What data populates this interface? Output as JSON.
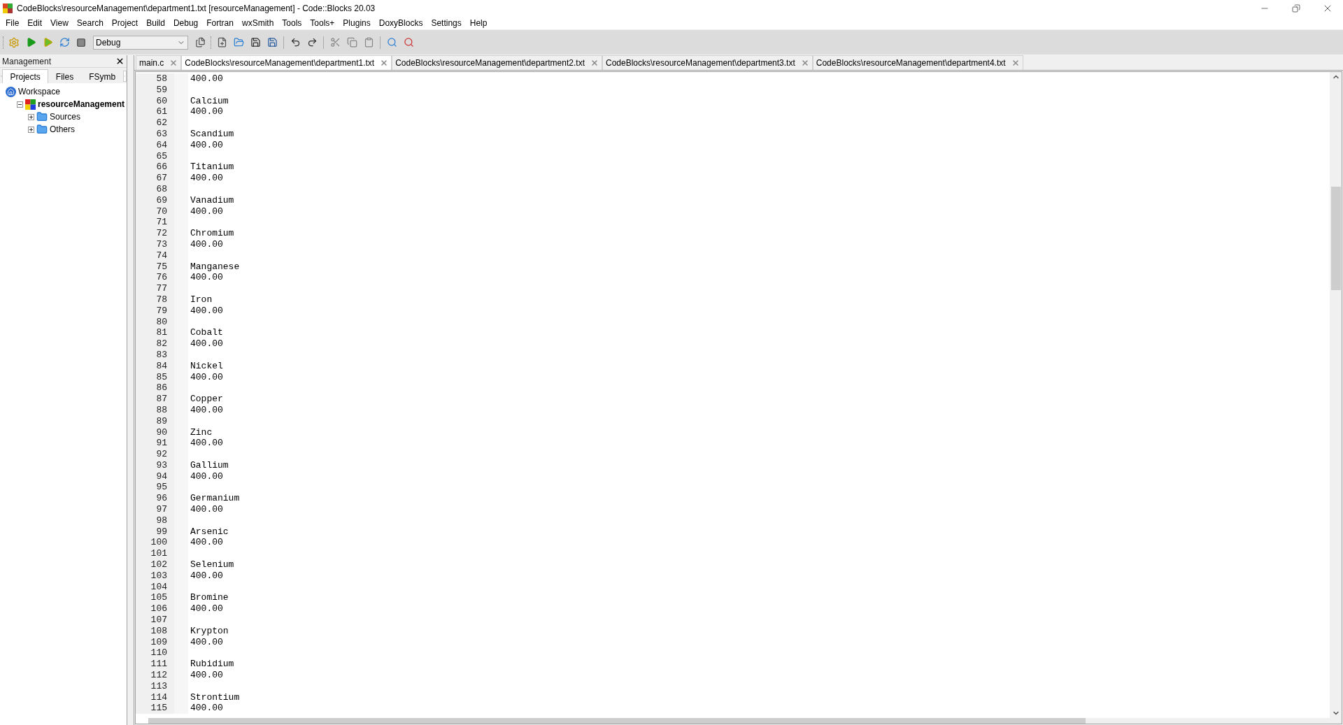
{
  "window": {
    "title": "CodeBlocks\\resourceManagement\\department1.txt [resourceManagement] - Code::Blocks 20.03"
  },
  "menu": [
    "File",
    "Edit",
    "View",
    "Search",
    "Project",
    "Build",
    "Debug",
    "Fortran",
    "wxSmith",
    "Tools",
    "Tools+",
    "Plugins",
    "DoxyBlocks",
    "Settings",
    "Help"
  ],
  "toolbar": {
    "build_target": "Debug"
  },
  "management": {
    "title": "Management",
    "tabs": [
      {
        "label": "Projects",
        "selected": true
      },
      {
        "label": "Files",
        "selected": false
      },
      {
        "label": "FSymb",
        "selected": false
      }
    ],
    "tree": [
      {
        "label": "Workspace",
        "kind": "workspace",
        "children": [
          {
            "label": "resourceManagement",
            "kind": "project",
            "expanded": true,
            "children": [
              {
                "label": "Sources",
                "kind": "folder",
                "expanded": false
              },
              {
                "label": "Others",
                "kind": "folder",
                "expanded": false
              }
            ]
          }
        ]
      }
    ]
  },
  "editor_tabs": [
    {
      "label": "main.c",
      "selected": false
    },
    {
      "label": "CodeBlocks\\resourceManagement\\department1.txt",
      "selected": true
    },
    {
      "label": "CodeBlocks\\resourceManagement\\department2.txt",
      "selected": false
    },
    {
      "label": "CodeBlocks\\resourceManagement\\department3.txt",
      "selected": false
    },
    {
      "label": "CodeBlocks\\resourceManagement\\department4.txt",
      "selected": false
    }
  ],
  "editor_lines": [
    {
      "number": "58",
      "text": "400.00"
    },
    {
      "number": "59"
    },
    {
      "number": "60",
      "text": "Calcium"
    },
    {
      "number": "61",
      "text": "400.00"
    },
    {
      "number": "62"
    },
    {
      "number": "63",
      "text": "Scandium"
    },
    {
      "number": "64",
      "text": "400.00"
    },
    {
      "number": "65"
    },
    {
      "number": "66",
      "text": "Titanium"
    },
    {
      "number": "67",
      "text": "400.00"
    },
    {
      "number": "68"
    },
    {
      "number": "69",
      "text": "Vanadium"
    },
    {
      "number": "70",
      "text": "400.00"
    },
    {
      "number": "71"
    },
    {
      "number": "72",
      "text": "Chromium"
    },
    {
      "number": "73",
      "text": "400.00"
    },
    {
      "number": "74"
    },
    {
      "number": "75",
      "text": "Manganese"
    },
    {
      "number": "76",
      "text": "400.00"
    },
    {
      "number": "77"
    },
    {
      "number": "78",
      "text": "Iron"
    },
    {
      "number": "79",
      "text": "400.00"
    },
    {
      "number": "80"
    },
    {
      "number": "81",
      "text": "Cobalt"
    },
    {
      "number": "82",
      "text": "400.00"
    },
    {
      "number": "83"
    },
    {
      "number": "84",
      "text": "Nickel"
    },
    {
      "number": "85",
      "text": "400.00"
    },
    {
      "number": "86"
    },
    {
      "number": "87",
      "text": "Copper"
    },
    {
      "number": "88",
      "text": "400.00"
    },
    {
      "number": "89"
    },
    {
      "number": "90",
      "text": "Zinc"
    },
    {
      "number": "91",
      "text": "400.00"
    },
    {
      "number": "92"
    },
    {
      "number": "93",
      "text": "Gallium"
    },
    {
      "number": "94",
      "text": "400.00"
    },
    {
      "number": "95"
    },
    {
      "number": "96",
      "text": "Germanium"
    },
    {
      "number": "97",
      "text": "400.00"
    },
    {
      "number": "98"
    },
    {
      "number": "99",
      "text": "Arsenic"
    },
    {
      "number": "100",
      "text": "400.00"
    },
    {
      "number": "101"
    },
    {
      "number": "102",
      "text": "Selenium"
    },
    {
      "number": "103",
      "text": "400.00"
    },
    {
      "number": "104"
    },
    {
      "number": "105",
      "text": "Bromine"
    },
    {
      "number": "106",
      "text": "400.00"
    },
    {
      "number": "107"
    },
    {
      "number": "108",
      "text": "Krypton"
    },
    {
      "number": "109",
      "text": "400.00"
    },
    {
      "number": "110"
    },
    {
      "number": "111",
      "text": "Rubidium"
    },
    {
      "number": "112",
      "text": "400.00"
    },
    {
      "number": "113"
    },
    {
      "number": "114",
      "text": "Strontium"
    },
    {
      "number": "115",
      "text": "400.00"
    }
  ]
}
